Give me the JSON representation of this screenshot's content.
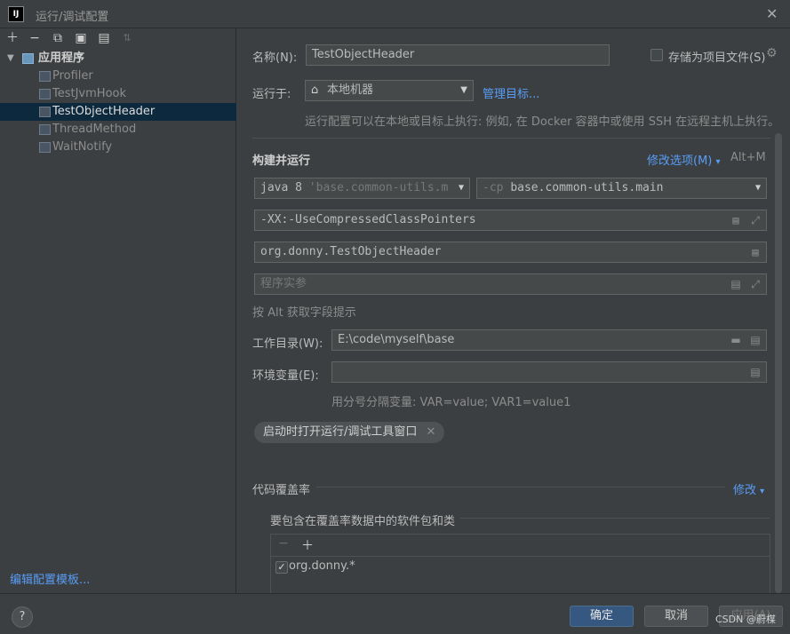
{
  "window": {
    "title": "运行/调试配置",
    "app_icon_text": "IJ"
  },
  "left": {
    "tree": {
      "root": "应用程序",
      "items": [
        {
          "label": "Profiler",
          "selected": false
        },
        {
          "label": "TestJvmHook",
          "selected": false
        },
        {
          "label": "TestObjectHeader",
          "selected": true
        },
        {
          "label": "ThreadMethod",
          "selected": false
        },
        {
          "label": "WaitNotify",
          "selected": false
        }
      ]
    },
    "edit_templates": "编辑配置模板..."
  },
  "form": {
    "name_label": "名称(N):",
    "name_value": "TestObjectHeader",
    "store_label": "存储为项目文件(S)",
    "run_on_label": "运行于:",
    "run_on_value": "本地机器",
    "manage_targets": "管理目标...",
    "run_on_hint": "运行配置可以在本地或目标上执行: 例如, 在 Docker 容器中或使用 SSH 在远程主机上执行。",
    "build_run_title": "构建并运行",
    "modify_options": "修改选项(M)",
    "modify_shortcut": "Alt+M",
    "jdk_value": "java 8",
    "jdk_module_hint": "'base.common-utils.m",
    "cp_prefix": "-cp",
    "cp_value": "base.common-utils.main",
    "vm_options": "-XX:-UseCompressedClassPointers",
    "main_class": "org.donny.TestObjectHeader",
    "program_args_placeholder": "程序实参",
    "alt_hint": "按 Alt 获取字段提示",
    "workdir_label": "工作目录(W):",
    "workdir_value": "E:\\code\\myself\\base",
    "env_label": "环境变量(E):",
    "env_value": "",
    "env_hint": "用分号分隔变量: VAR=value; VAR1=value1",
    "chip_label": "启动时打开运行/调试工具窗口",
    "coverage_title": "代码覆盖率",
    "coverage_modify": "修改",
    "coverage_include_label": "要包含在覆盖率数据中的软件包和类",
    "coverage_item": "org.donny.*"
  },
  "buttons": {
    "ok": "确定",
    "cancel": "取消",
    "apply": "应用(A)"
  },
  "watermark": "CSDN @蔚楳",
  "colors": {
    "accent": "#589df6",
    "primary_button": "#365880",
    "selection": "#0d293e"
  }
}
